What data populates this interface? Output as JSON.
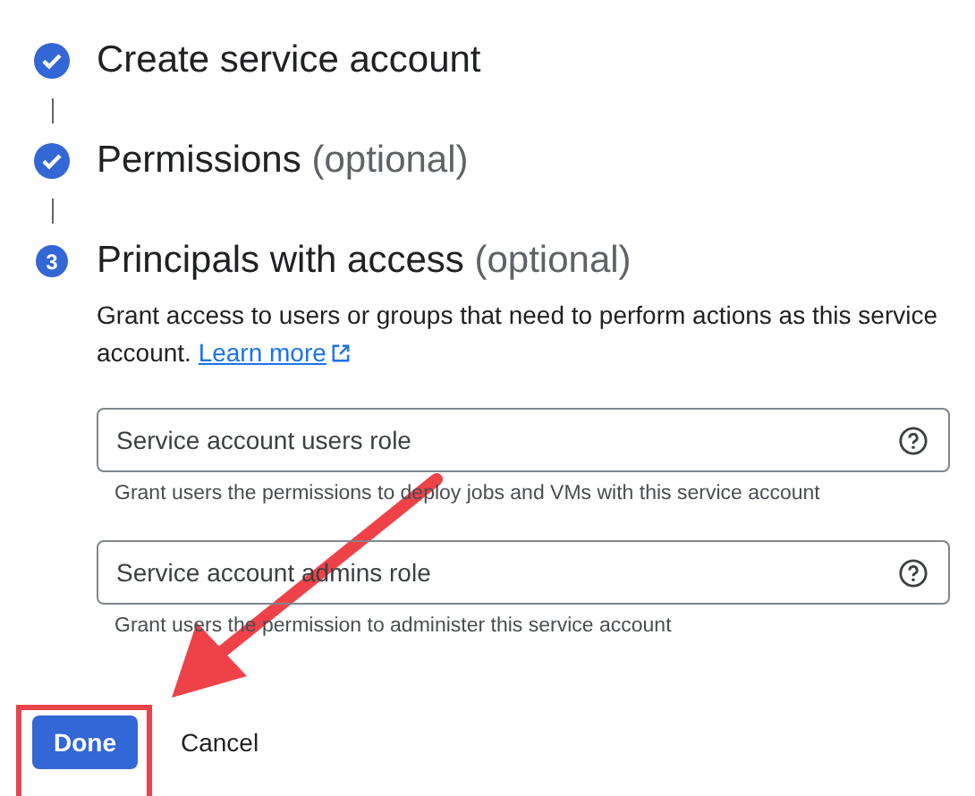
{
  "steps": [
    {
      "completed": true,
      "title": "Create service account"
    },
    {
      "completed": true,
      "title": "Permissions",
      "suffix": "(optional)"
    },
    {
      "completed": false,
      "number": "3",
      "title": "Principals with access",
      "suffix": "(optional)"
    }
  ],
  "description": "Grant access to users or groups that need to perform actions as this service account.",
  "learn_more": "Learn more",
  "fields": [
    {
      "placeholder": "Service account users role",
      "helper": "Grant users the permissions to deploy jobs and VMs with this service account"
    },
    {
      "placeholder": "Service account admins role",
      "helper": "Grant users the permission to administer this service account"
    }
  ],
  "buttons": {
    "done": "Done",
    "cancel": "Cancel"
  }
}
